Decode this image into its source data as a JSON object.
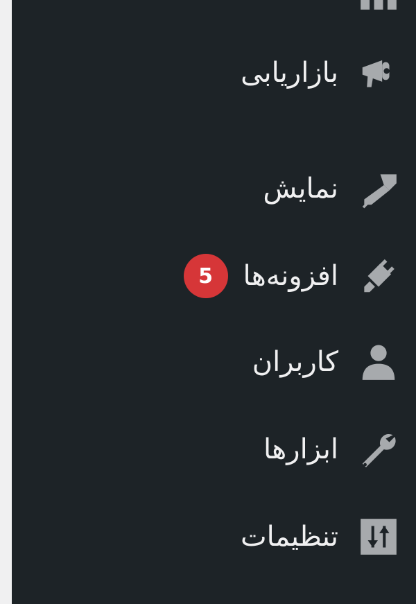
{
  "menu": {
    "items": [
      {
        "label": "",
        "icon": "dashboard-icon"
      },
      {
        "label": "بازاریابی",
        "icon": "megaphone-icon"
      },
      {
        "label": "نمایش",
        "icon": "paintbrush-icon"
      },
      {
        "label": "افزونه‌ها",
        "icon": "plugin-icon",
        "badge": "5"
      },
      {
        "label": "کاربران",
        "icon": "user-icon"
      },
      {
        "label": "ابزارها",
        "icon": "wrench-icon"
      },
      {
        "label": "تنظیمات",
        "icon": "settings-sliders-icon"
      }
    ]
  },
  "colors": {
    "sidebar_bg": "#1d2327",
    "page_bg": "#f0f0f1",
    "text": "#f0f0f1",
    "icon": "#a7aaad",
    "badge_bg": "#d63638"
  }
}
